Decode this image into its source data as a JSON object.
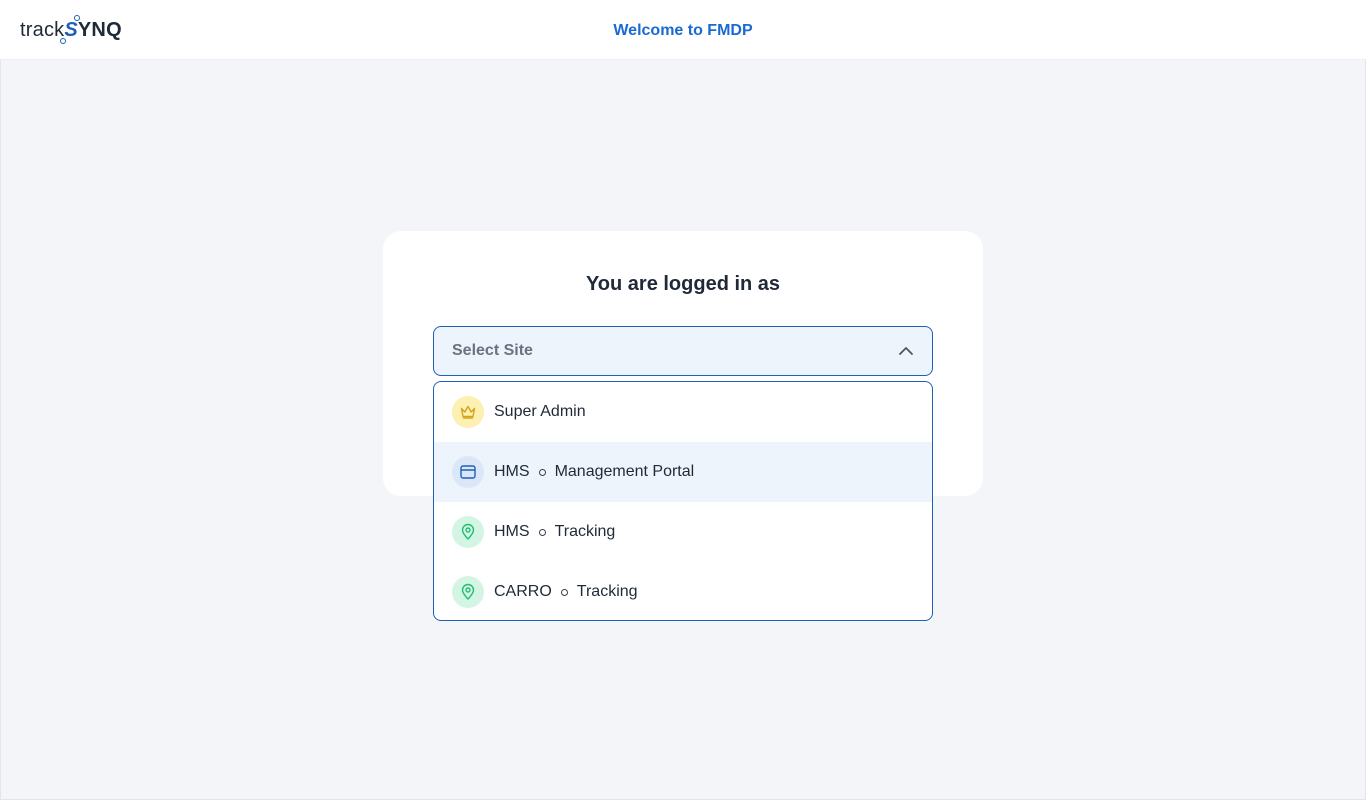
{
  "header": {
    "logo_track": "track",
    "logo_s": "S",
    "logo_ynq": "YNQ",
    "title": "Welcome to FMDP"
  },
  "card": {
    "title": "You are logged in as"
  },
  "select": {
    "placeholder": "Select Site",
    "expanded": true
  },
  "options": [
    {
      "icon": "crown-icon",
      "parts": [
        "Super Admin"
      ],
      "highlighted": false
    },
    {
      "icon": "browser-window-icon",
      "parts": [
        "HMS",
        "Management Portal"
      ],
      "highlighted": true
    },
    {
      "icon": "map-pin-icon",
      "parts": [
        "HMS",
        "Tracking"
      ],
      "highlighted": false
    },
    {
      "icon": "map-pin-icon",
      "parts": [
        "CARRO",
        "Tracking"
      ],
      "highlighted": false
    }
  ],
  "colors": {
    "brand_blue": "#1e5fb8",
    "header_title": "#1a6bd1",
    "page_bg": "#f4f5f9",
    "crown_bg": "#fdf0b3",
    "crown_fg": "#d4a514",
    "window_bg": "#dbe7f8",
    "window_fg": "#1e5fb8",
    "pin_bg": "#d5f5e4",
    "pin_fg": "#1fbf73"
  }
}
